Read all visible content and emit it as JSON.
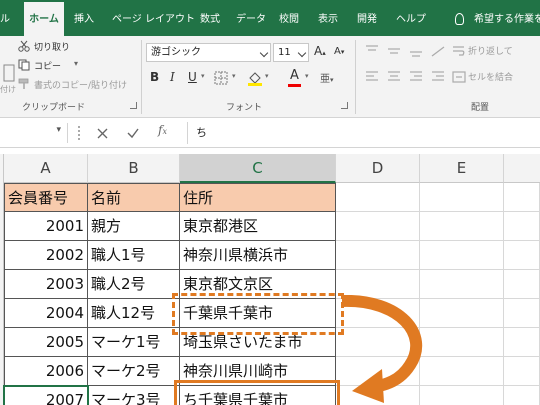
{
  "tabs": [
    {
      "label": "ル",
      "active": false
    },
    {
      "label": "ホーム",
      "active": true
    },
    {
      "label": "挿入",
      "active": false
    },
    {
      "label": "ページ レイアウト",
      "active": false
    },
    {
      "label": "数式",
      "active": false
    },
    {
      "label": "データ",
      "active": false
    },
    {
      "label": "校閲",
      "active": false
    },
    {
      "label": "表示",
      "active": false
    },
    {
      "label": "開発",
      "active": false
    },
    {
      "label": "ヘルプ",
      "active": false
    }
  ],
  "tell_me": "希望する作業を入",
  "clipboard": {
    "cut": "切り取り",
    "copy": "コピー",
    "format_painter": "書式のコピー/貼り付け",
    "paste_partial": "付け",
    "group": "クリップボード"
  },
  "font": {
    "name": "游ゴシック",
    "size": "11",
    "group": "フォント"
  },
  "alignment": {
    "wrap": "折り返して",
    "merge": "セルを結合",
    "group": "配置"
  },
  "formula_bar": {
    "content": "ち"
  },
  "columns": [
    "A",
    "B",
    "C",
    "D",
    "E"
  ],
  "table": {
    "headers": [
      "会員番号",
      "名前",
      "住所"
    ],
    "rows": [
      [
        "2001",
        "親方",
        "東京都港区"
      ],
      [
        "2002",
        "職人1号",
        "神奈川県横浜市"
      ],
      [
        "2003",
        "職人2号",
        "東京都文京区"
      ],
      [
        "2004",
        "職人12号",
        "千葉県千葉市"
      ],
      [
        "2005",
        "マーケ1号",
        "埼玉県さいたま市"
      ],
      [
        "2006",
        "マーケ2号",
        "神奈川県川崎市"
      ],
      [
        "2007",
        "マーケ3号",
        "ち千葉県千葉市"
      ]
    ]
  },
  "colors": {
    "excel_green": "#217346",
    "header_fill": "#f8cbad",
    "annotation_orange": "#e07a22"
  }
}
